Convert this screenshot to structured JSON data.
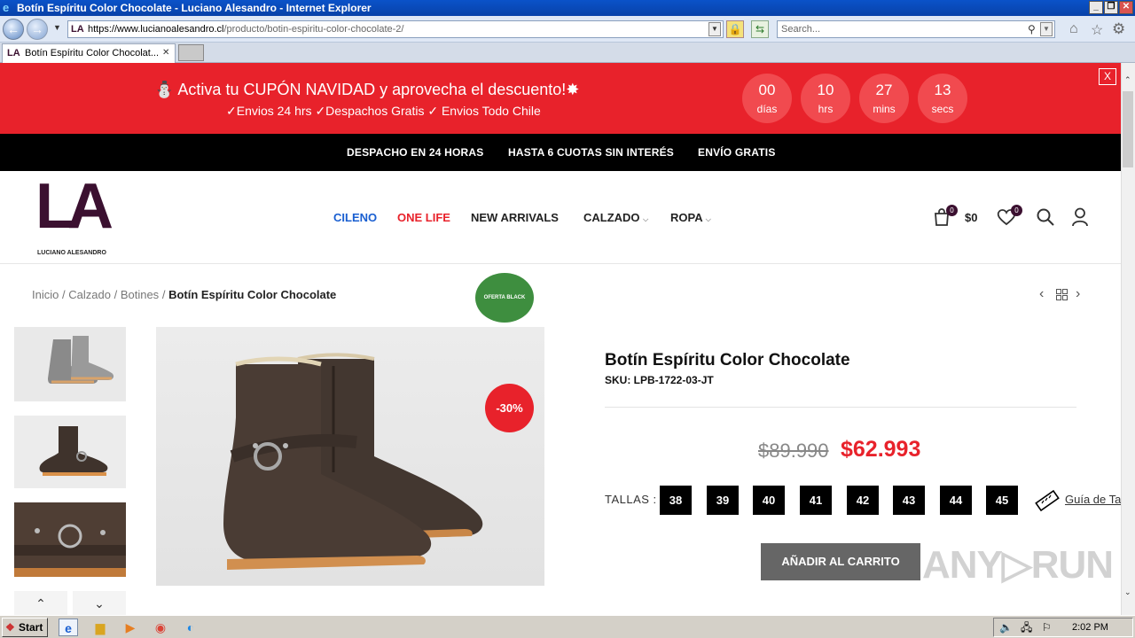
{
  "window": {
    "title": "Botín Espíritu Color Chocolate - Luciano Alesandro - Internet Explorer",
    "min": "_",
    "restore": "❐",
    "close": "✕"
  },
  "browser": {
    "url_prefix": "https://www.",
    "url_domain": "lucianoalesandro.cl",
    "url_path": "/producto/botin-espiritu-color-chocolate-2/",
    "search_placeholder": "Search...",
    "tab_title": "Botín Espíritu Color Chocolat...",
    "tab_close": "✕"
  },
  "promo": {
    "headline": "⛄ Activa tu CUPÓN NAVIDAD y aprovecha el descuento!✸",
    "subline": "✓Envios 24 hrs ✓Despachos Gratis ✓ Envios Todo Chile",
    "countdown": [
      {
        "value": "00",
        "label": "días"
      },
      {
        "value": "10",
        "label": "hrs"
      },
      {
        "value": "27",
        "label": "mins"
      },
      {
        "value": "13",
        "label": "secs"
      }
    ],
    "close": "X"
  },
  "topbar": {
    "items": [
      "DESPACHO EN 24 HORAS",
      "HASTA 6 CUOTAS SIN INTERÉS",
      "ENVÍO GRATIS"
    ]
  },
  "header": {
    "logo": "LA",
    "logo_text": "LUCIANO ALESANDRO",
    "nav": [
      {
        "label": "CILENO",
        "color": "#1a5fd1"
      },
      {
        "label": "ONE LIFE",
        "color": "#e8222b"
      },
      {
        "label": "NEW ARRIVALS",
        "color": "#222222"
      },
      {
        "label": "CALZADO",
        "color": "#222222"
      },
      {
        "label": "ROPA",
        "color": "#222222"
      }
    ],
    "cart_count": "0",
    "cart_total": "$0",
    "wishlist_count": "0"
  },
  "breadcrumb": {
    "items": [
      "Inicio",
      "Calzado",
      "Botines"
    ],
    "sep": "/",
    "current": "Botín Espíritu Color Chocolate"
  },
  "product": {
    "oferta_badge": "OFERTA BLACK",
    "discount_badge": "-30%",
    "title": "Botín Espíritu Color Chocolate",
    "sku": "SKU: LPB-1722-03-JT",
    "old_price": "$89.990",
    "new_price": "$62.993",
    "sizes_label": "TALLAS :",
    "sizes": [
      "38",
      "39",
      "40",
      "41",
      "42",
      "43",
      "44",
      "45"
    ],
    "size_guide": "Guía de Ta",
    "add_to_cart": "AÑADIR AL CARRITO"
  },
  "watermark": "ANY▷RUN",
  "taskbar": {
    "start": "Start",
    "time": "2:02 PM"
  }
}
